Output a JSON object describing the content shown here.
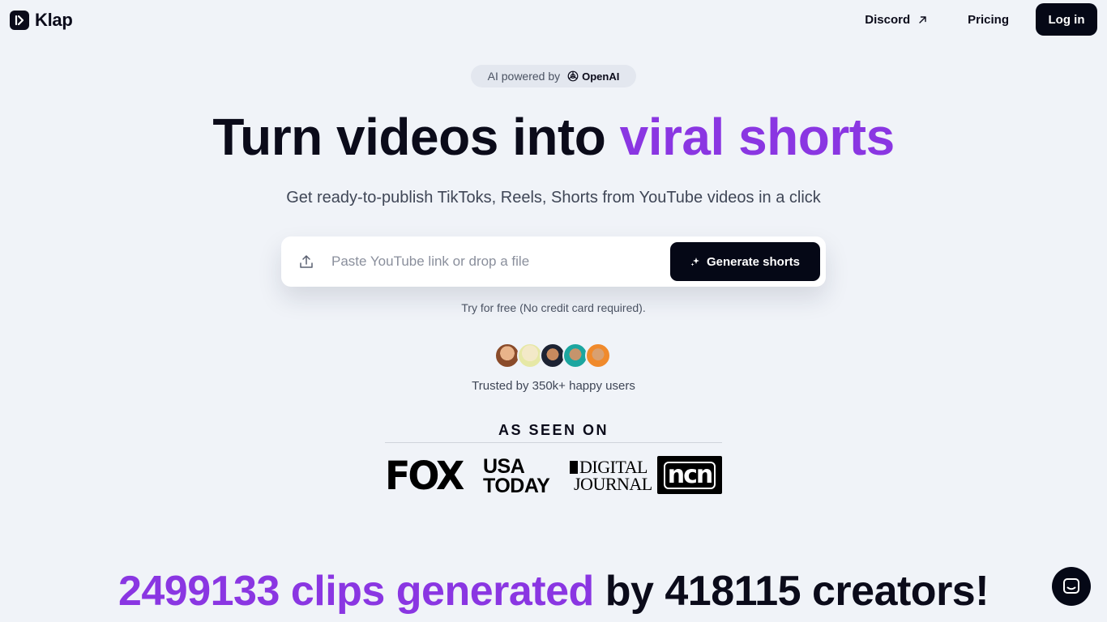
{
  "header": {
    "logo_text": "Klap",
    "discord_label": "Discord",
    "pricing_label": "Pricing",
    "login_label": "Log in"
  },
  "badge": {
    "prefix": "AI powered by",
    "brand": "OpenAI"
  },
  "hero": {
    "title_plain": "Turn videos into ",
    "title_accent": "viral shorts",
    "subtitle": "Get ready-to-publish TikToks, Reels, Shorts from YouTube videos in a click"
  },
  "input": {
    "placeholder": "Paste YouTube link or drop a file",
    "value": "",
    "button_label": "Generate shorts"
  },
  "try_free": "Try for free (No credit card required).",
  "trusted": "Trusted by 350k+ happy users",
  "as_seen_on": {
    "title": "AS SEEN ON",
    "outlets": [
      "FOX",
      "USA TODAY",
      "DIGITAL JOURNAL",
      "ncn"
    ]
  },
  "stats": {
    "accent": "2499133 clips generated",
    "plain": " by 418115 creators!"
  },
  "colors": {
    "accent": "#8a36e2",
    "background": "#f0f3f8",
    "dark": "#050816"
  },
  "icons": [
    "klap-logo-icon",
    "external-arrow-icon",
    "openai-icon",
    "upload-icon",
    "sparkle-icon",
    "chat-icon"
  ]
}
